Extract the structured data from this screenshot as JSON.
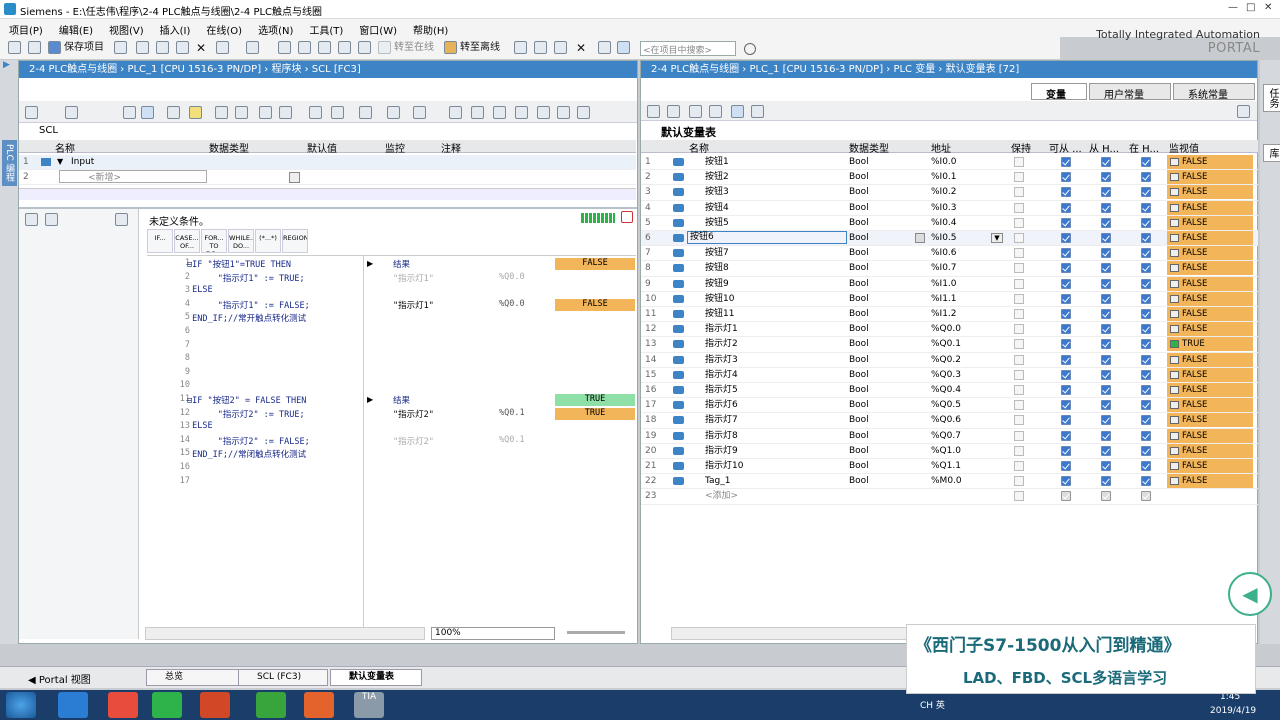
{
  "window": {
    "title": "Siemens  -  E:\\任志伟\\程序\\2-4 PLC触点与线圈\\2-4 PLC触点与线圈"
  },
  "menu": [
    "项目(P)",
    "编辑(E)",
    "视图(V)",
    "插入(I)",
    "在线(O)",
    "选项(N)",
    "工具(T)",
    "窗口(W)",
    "帮助(H)"
  ],
  "toolbar": {
    "save": "保存项目",
    "go_online": "转至在线",
    "go_offline": "转至离线",
    "search_placeholder": "<在项目中搜索>"
  },
  "brand": {
    "line1": "Totally Integrated Automation",
    "line2": "PORTAL"
  },
  "left": {
    "breadcrumb": "2-4 PLC触点与线圈  ›  PLC_1 [CPU 1516-3 PN/DP]  ›  程序块  ›  SCL [FC3]",
    "block_name": "SCL",
    "iface_cols": [
      "名称",
      "数据类型",
      "默认值",
      "监控",
      "注释"
    ],
    "iface_rows": [
      {
        "n": "1",
        "name": "Input"
      },
      {
        "n": "2",
        "name": "<新增>"
      }
    ],
    "condition": "未定义条件。",
    "keywords": [
      "IF...",
      "CASE... OF...",
      "FOR... TO DO...",
      "WHILE... DO...",
      "(*...*)",
      "REGION"
    ],
    "code": [
      {
        "n": "1",
        "t": "⊟IF \"按钮1\"=TRUE THEN"
      },
      {
        "n": "2",
        "t": "      \"指示灯1\" := TRUE;"
      },
      {
        "n": "3",
        "t": " ELSE"
      },
      {
        "n": "4",
        "t": "      \"指示灯1\" := FALSE;"
      },
      {
        "n": "5",
        "t": " END_IF;//常开触点转化测试"
      },
      {
        "n": "6",
        "t": ""
      },
      {
        "n": "7",
        "t": ""
      },
      {
        "n": "8",
        "t": ""
      },
      {
        "n": "9",
        "t": ""
      },
      {
        "n": "10",
        "t": ""
      },
      {
        "n": "11",
        "t": "⊟IF \"按钮2\" = FALSE THEN"
      },
      {
        "n": "12",
        "t": "      \"指示灯2\" := TRUE;"
      },
      {
        "n": "13",
        "t": " ELSE"
      },
      {
        "n": "14",
        "t": "      \"指示灯2\" := FALSE;"
      },
      {
        "n": "15",
        "t": " END_IF;//常闭触点转化测试"
      },
      {
        "n": "16",
        "t": ""
      },
      {
        "n": "17",
        "t": ""
      }
    ],
    "monitor": [
      {
        "row": 0,
        "name": "结果",
        "addr": "",
        "val": "FALSE",
        "c": "#f3b55a",
        "blue": true
      },
      {
        "row": 1,
        "name": "\"指示灯1\"",
        "addr": "%Q0.0",
        "val": "",
        "c": "",
        "grey": true
      },
      {
        "row": 3,
        "name": "\"指示灯1\"",
        "addr": "%Q0.0",
        "val": "FALSE",
        "c": "#f3b55a"
      },
      {
        "row": 10,
        "name": "结果",
        "addr": "",
        "val": "TRUE",
        "c": "#8fe0a6",
        "blue": true
      },
      {
        "row": 11,
        "name": "\"指示灯2\"",
        "addr": "%Q0.1",
        "val": "TRUE",
        "c": "#f3b55a"
      },
      {
        "row": 13,
        "name": "\"指示灯2\"",
        "addr": "%Q0.1",
        "val": "",
        "c": "",
        "grey": true
      }
    ],
    "zoom": "100%"
  },
  "right": {
    "breadcrumb": "2-4 PLC触点与线圈  ›  PLC_1 [CPU 1516-3 PN/DP]  ›  PLC 变量  ›  默认变量表 [72]",
    "tabs": [
      "变量",
      "用户常量",
      "系统常量"
    ],
    "table_title": "默认变量表",
    "cols": [
      "名称",
      "数据类型",
      "地址",
      "保持",
      "可从 ...",
      "从 H...",
      "在 H...",
      "监视值"
    ],
    "rows": [
      {
        "n": "1",
        "name": "按钮1",
        "type": "Bool",
        "addr": "%I0.0",
        "val": "FALSE"
      },
      {
        "n": "2",
        "name": "按钮2",
        "type": "Bool",
        "addr": "%I0.1",
        "val": "FALSE"
      },
      {
        "n": "3",
        "name": "按钮3",
        "type": "Bool",
        "addr": "%I0.2",
        "val": "FALSE"
      },
      {
        "n": "4",
        "name": "按钮4",
        "type": "Bool",
        "addr": "%I0.3",
        "val": "FALSE"
      },
      {
        "n": "5",
        "name": "按钮5",
        "type": "Bool",
        "addr": "%I0.4",
        "val": "FALSE"
      },
      {
        "n": "6",
        "name": "按钮6",
        "type": "Bool",
        "addr": "%I0.5",
        "val": "FALSE"
      },
      {
        "n": "7",
        "name": "按钮7",
        "type": "Bool",
        "addr": "%I0.6",
        "val": "FALSE"
      },
      {
        "n": "8",
        "name": "按钮8",
        "type": "Bool",
        "addr": "%I0.7",
        "val": "FALSE"
      },
      {
        "n": "9",
        "name": "按钮9",
        "type": "Bool",
        "addr": "%I1.0",
        "val": "FALSE"
      },
      {
        "n": "10",
        "name": "按钮10",
        "type": "Bool",
        "addr": "%I1.1",
        "val": "FALSE"
      },
      {
        "n": "11",
        "name": "按钮11",
        "type": "Bool",
        "addr": "%I1.2",
        "val": "FALSE"
      },
      {
        "n": "12",
        "name": "指示灯1",
        "type": "Bool",
        "addr": "%Q0.0",
        "val": "FALSE"
      },
      {
        "n": "13",
        "name": "指示灯2",
        "type": "Bool",
        "addr": "%Q0.1",
        "val": "TRUE"
      },
      {
        "n": "14",
        "name": "指示灯3",
        "type": "Bool",
        "addr": "%Q0.2",
        "val": "FALSE"
      },
      {
        "n": "15",
        "name": "指示灯4",
        "type": "Bool",
        "addr": "%Q0.3",
        "val": "FALSE"
      },
      {
        "n": "16",
        "name": "指示灯5",
        "type": "Bool",
        "addr": "%Q0.4",
        "val": "FALSE"
      },
      {
        "n": "17",
        "name": "指示灯6",
        "type": "Bool",
        "addr": "%Q0.5",
        "val": "FALSE"
      },
      {
        "n": "18",
        "name": "指示灯7",
        "type": "Bool",
        "addr": "%Q0.6",
        "val": "FALSE"
      },
      {
        "n": "19",
        "name": "指示灯8",
        "type": "Bool",
        "addr": "%Q0.7",
        "val": "FALSE"
      },
      {
        "n": "20",
        "name": "指示灯9",
        "type": "Bool",
        "addr": "%Q1.0",
        "val": "FALSE"
      },
      {
        "n": "21",
        "name": "指示灯10",
        "type": "Bool",
        "addr": "%Q1.1",
        "val": "FALSE"
      },
      {
        "n": "22",
        "name": "Tag_1",
        "type": "Bool",
        "addr": "%M0.0",
        "val": "FALSE"
      },
      {
        "n": "23",
        "name": "<添加>",
        "type": "",
        "addr": "",
        "val": ""
      }
    ]
  },
  "side_left": "PLC 编程",
  "side_right": [
    "任务",
    "库"
  ],
  "portal": {
    "label": "Portal 视图",
    "tabs": [
      "总览",
      "SCL (FC3)",
      "默认变量表"
    ]
  },
  "overlay": {
    "line1": "《西门子S7-1500从入门到精通》",
    "line2": "LAD、FBD、SCL多语言学习"
  },
  "tray": {
    "time": "1:45",
    "date": "2019/4/19",
    "lang": "CH 英"
  },
  "colors": {
    "panel_header": "#3d84c6",
    "false_bg": "#f3b55a",
    "true_bg": "#8fe0a6",
    "overlay_text": "#1a6a7a"
  }
}
